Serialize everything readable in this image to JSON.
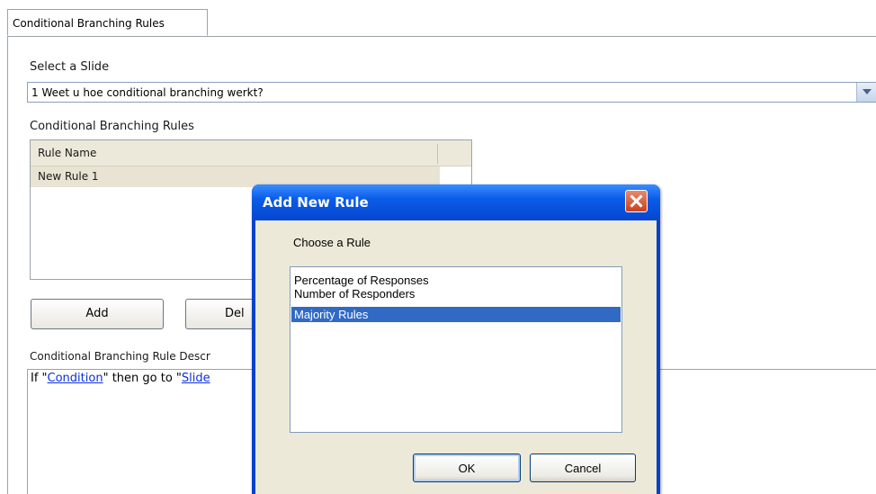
{
  "tabs": [
    {
      "label": "Conditional Branching Rules",
      "active": true
    }
  ],
  "slide_select": {
    "label": "Select a Slide",
    "value": "1 Weet u hoe conditional branching werkt?"
  },
  "rules_section": {
    "label": "Conditional Branching Rules",
    "column_header": "Rule Name",
    "rows": [
      "New Rule 1"
    ]
  },
  "buttons": {
    "add": "Add",
    "delete_partial": "Del"
  },
  "description": {
    "label": "Conditional Branching Rule Descr",
    "prefix": "If \"",
    "condition_link": "Condition",
    "middle": "\" then go to \"",
    "slide_link": "Slide"
  },
  "dialog": {
    "title": "Add New Rule",
    "choose_label": "Choose a Rule",
    "options": [
      "Percentage of Responses",
      "Number of Responders",
      "Majority Rules"
    ],
    "selected_index": 2,
    "ok": "OK",
    "cancel": "Cancel"
  },
  "colors": {
    "selection": "#316ac5",
    "titlebar": "#0a5ce8",
    "link": "#0b2fd8"
  }
}
